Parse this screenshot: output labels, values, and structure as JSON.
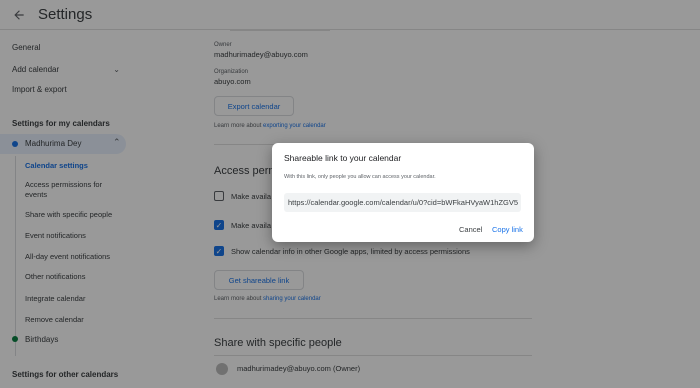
{
  "app": {
    "title": "Settings"
  },
  "sidebar": {
    "general": "General",
    "add_calendar": "Add calendar",
    "import_export": "Import & export",
    "my_calendars_heading": "Settings for my calendars",
    "calendar_name": "Madhurima Dey",
    "subitems": [
      "Calendar settings",
      "Access permissions for events",
      "Share with specific people",
      "Event notifications",
      "All-day event notifications",
      "Other notifications",
      "Integrate calendar",
      "Remove calendar"
    ],
    "birthdays": "Birthdays",
    "other_calendars_heading": "Settings for other calendars"
  },
  "main": {
    "owner_label": "Owner",
    "owner_value": "madhurimadey@abuyo.com",
    "org_label": "Organization",
    "org_value": "abuyo.com",
    "export_button": "Export calendar",
    "learn_export_prefix": "Learn more about",
    "learn_export_link": "exporting your calendar",
    "access_heading": "Access permi",
    "check1": "Make availa",
    "check2": "Make availa",
    "check3": "Show calendar info in other Google apps, limited by access permissions",
    "get_link_button": "Get shareable link",
    "learn_share_prefix": "Learn more about",
    "learn_share_link": "sharing your calendar",
    "share_heading": "Share with specific people",
    "share_person": "madhurimadey@abuyo.com (Owner)"
  },
  "dialog": {
    "title": "Shareable link to your calendar",
    "description": "With this link, only people you allow can access your calendar.",
    "link": "https://calendar.google.com/calendar/u/0?cid=bWFkaHVyaW1hZGV5",
    "cancel": "Cancel",
    "copy": "Copy link"
  },
  "colors": {
    "accent": "#1a73e8",
    "calendar_dot": "#1a73e8",
    "birthday_dot": "#0b8043"
  },
  "icons": {
    "back": "arrow-back-icon",
    "chevron": "chevron-down-icon"
  }
}
